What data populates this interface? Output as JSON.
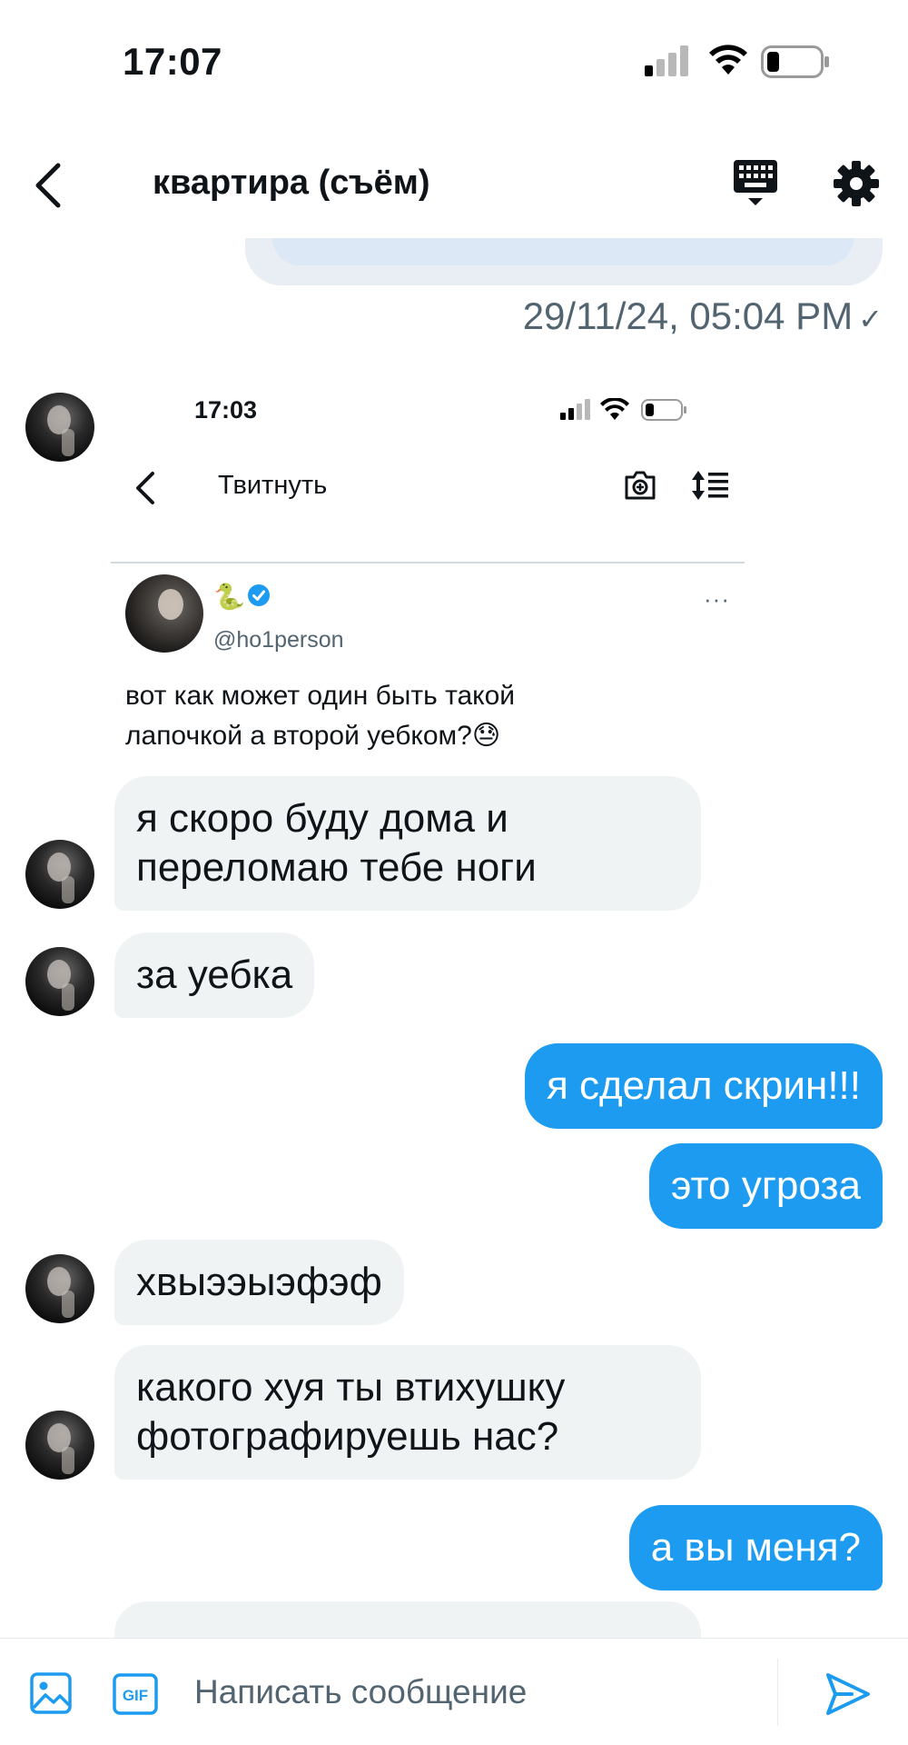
{
  "status_bar": {
    "time": "17:07"
  },
  "header": {
    "title": "квартира (съём)"
  },
  "prev_message": {
    "timestamp": "29/11/24, 05:04 PM",
    "status": "✓"
  },
  "screenshot": {
    "time": "17:03",
    "title": "Твитнуть",
    "tweet": {
      "name_emoji": "🐍",
      "handle": "@ho1person",
      "more": "···",
      "text": "вот как может один быть такой лапочкой а второй уебком?😓"
    }
  },
  "messages": [
    {
      "direction": "in",
      "text": "я скоро буду дома и переломаю тебе ноги"
    },
    {
      "direction": "in",
      "text": "за уебка"
    },
    {
      "direction": "out",
      "text": "я сделал скрин!!!"
    },
    {
      "direction": "out",
      "text": "это угроза"
    },
    {
      "direction": "in",
      "text": "хвыээыэфэф"
    },
    {
      "direction": "in",
      "text": "какого хуя ты втихушку фотографируешь нас?"
    },
    {
      "direction": "out",
      "text": "а вы меня?"
    }
  ],
  "composer": {
    "placeholder": "Написать сообщение",
    "gif_label": "GIF"
  },
  "colors": {
    "accent": "#1d9bf0",
    "incoming_bubble": "#eff3f4",
    "muted_text": "#536471"
  }
}
